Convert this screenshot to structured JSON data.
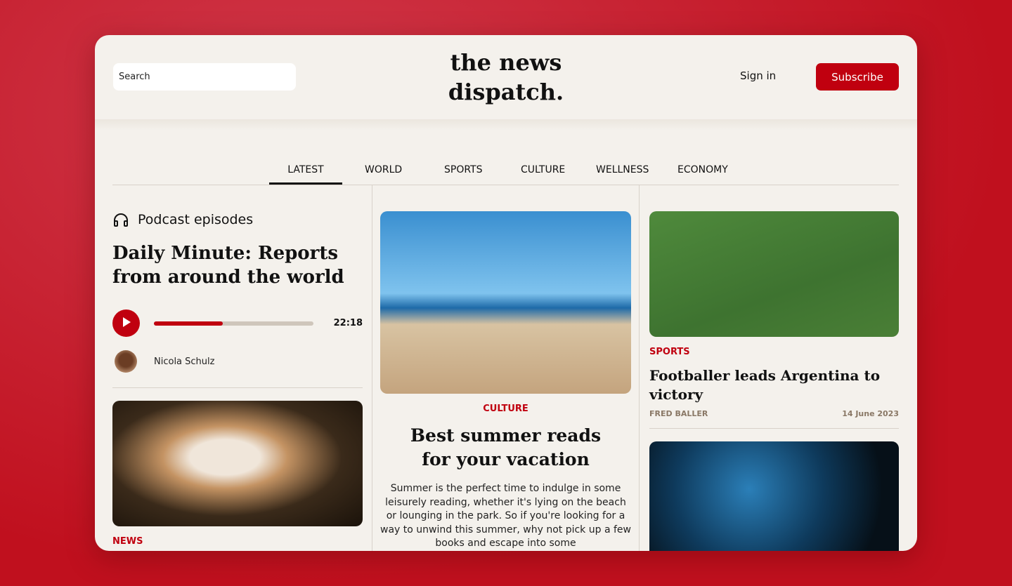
{
  "header": {
    "search_placeholder": "Search",
    "logo_line1": "the news",
    "logo_line2": "dispatch.",
    "sign_in": "Sign in",
    "subscribe": "Subscribe"
  },
  "nav": {
    "tabs": [
      {
        "label": "LATEST",
        "active": true
      },
      {
        "label": "WORLD"
      },
      {
        "label": "SPORTS"
      },
      {
        "label": "CULTURE"
      },
      {
        "label": "WELLNESS"
      },
      {
        "label": "ECONOMY"
      }
    ]
  },
  "podcast": {
    "section": "Podcast episodes",
    "icon": "headphones-icon",
    "title": "Daily Minute: Reports from around the world",
    "progress_percent": 43,
    "duration": "22:18",
    "author": "Nicola Schulz"
  },
  "left_story": {
    "category": "NEWS"
  },
  "center_story": {
    "category": "CULTURE",
    "title": "Best summer reads for your vacation",
    "body": "Summer is the perfect time to indulge in some leisurely reading, whether it's lying on the beach or lounging in the park. So if you're looking for a way to unwind this summer, why not pick up a few books and escape into some"
  },
  "right_story": {
    "category": "SPORTS",
    "title": "Footballer leads Argentina to victory",
    "author": "FRED BALLER",
    "date": "14 June 2023"
  },
  "colors": {
    "accent": "#c0000f",
    "background": "#f4f1ec"
  }
}
